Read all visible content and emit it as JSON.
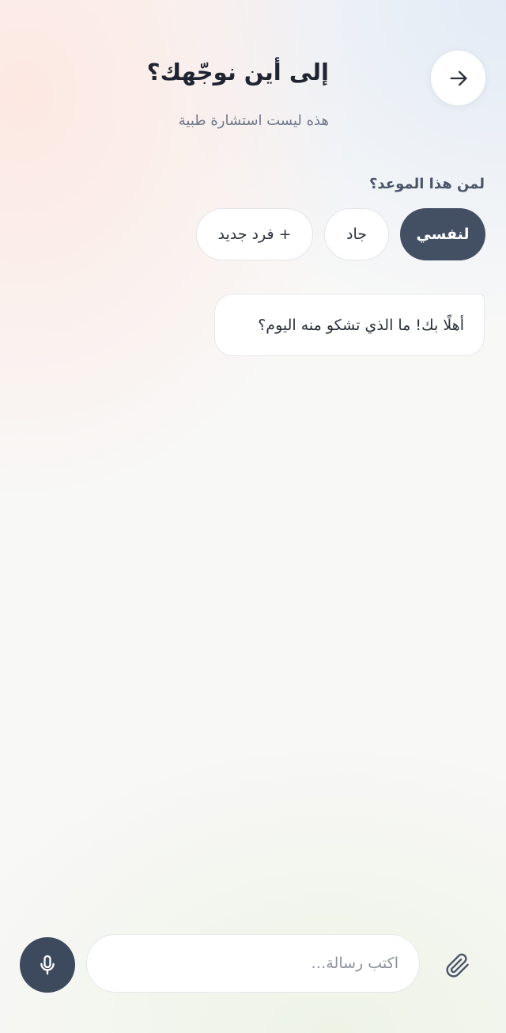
{
  "header": {
    "title": "إلى أين نوجّهك؟",
    "subtitle": "هذه ليست استشارة طبية",
    "back_icon": "arrow-right-icon"
  },
  "appointment": {
    "question": "لمن هذا الموعد؟",
    "options": [
      {
        "label": "لنفسي",
        "selected": true
      },
      {
        "label": "جاد",
        "selected": false
      },
      {
        "label": "+ فرد جديد",
        "selected": false
      }
    ]
  },
  "chat": {
    "messages": [
      {
        "text": "أهلًا بك! ما الذي تشكو منه اليوم؟"
      }
    ]
  },
  "composer": {
    "placeholder": "اكتب رسالة…",
    "value": "",
    "mic_icon": "microphone-icon",
    "attach_icon": "paperclip-icon"
  },
  "colors": {
    "primary": "#434f63",
    "mic_button": "#3d4a5e",
    "text": "#1f2430",
    "muted": "#6d7686"
  }
}
